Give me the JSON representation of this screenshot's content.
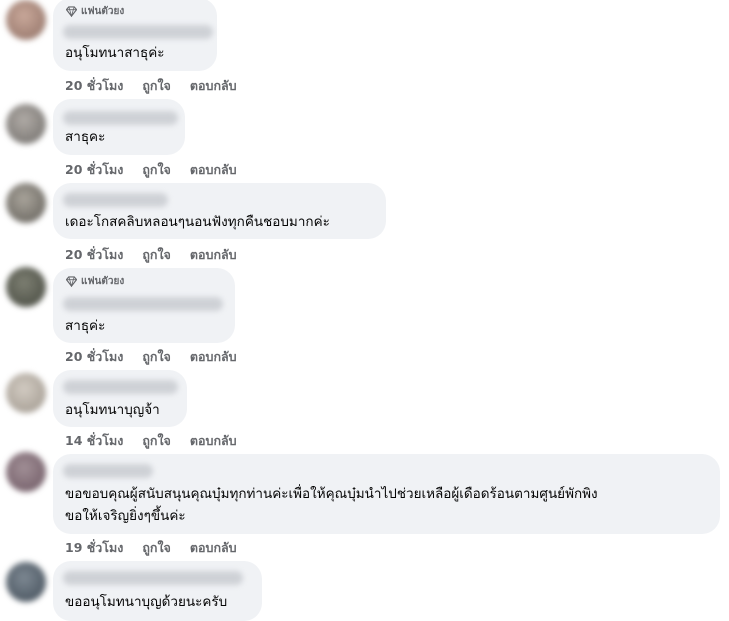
{
  "badge_label": "แฟนตัวยง",
  "like_label": "ถูกใจ",
  "reply_label": "ตอบกลับ",
  "comments": [
    {
      "text": "อนุโมทนาสาธุค่ะ",
      "time": "20 ชั่วโมง",
      "top_fan": true
    },
    {
      "text": "สาธุคะ",
      "time": "20 ชั่วโมง",
      "top_fan": false
    },
    {
      "text": "เดอะโกสคลิบหลอนๆนอนฟังทุกคืนชอบมากค่ะ",
      "time": "20 ชั่วโมง",
      "top_fan": false
    },
    {
      "text": "สาธุค่ะ",
      "time": "20 ชั่วโมง",
      "top_fan": true
    },
    {
      "text": "อนุโมทนาบุญจ้า",
      "time": "14 ชั่วโมง",
      "top_fan": false
    },
    {
      "text_line1": "ขอขอบคุณผู้สนับสนุนคุณบุ๋มทุกท่านค่ะเพื่อให้คุณบุ๋มนำไปช่วยเหลือผู้เดือดร้อนตามศูนย์พักพิง",
      "text_line2": "ขอให้เจริญยิ่งๆขึ้นค่ะ",
      "time": "19 ชั่วโมง",
      "top_fan": false
    },
    {
      "text": "ขออนุโมทนาบุญด้วยนะครับ",
      "time": "",
      "top_fan": false
    }
  ],
  "colors": {
    "bubble": "#f0f2f5",
    "meta_text": "#65676b",
    "text": "#050505"
  },
  "icons": {
    "badge": "diamond-icon"
  }
}
